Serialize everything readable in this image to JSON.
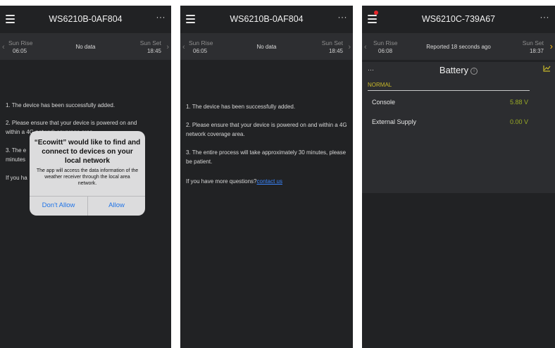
{
  "screen1": {
    "title": "WS6210B-0AF804",
    "more": "···",
    "sunrise_label": "Sun Rise",
    "sunrise_time": "06:05",
    "status": "No data",
    "sunset_label": "Sun Set",
    "sunset_time": "18:45",
    "msg1": "1. The device has been successfully added.",
    "msg2a": "2. Please ensure that your device is powered on and",
    "msg2b": "within a 4G network coverage area.",
    "msg3a": "3. The e",
    "msg3b": "minutes",
    "msg4": "If you ha",
    "alert": {
      "title": "“Ecowitt” would like to find and connect to devices on your local network",
      "body": "The app will access the data information of the weather receiver through the local area network.",
      "deny": "Don't Allow",
      "allow": "Allow"
    }
  },
  "screen2": {
    "title": "WS6210B-0AF804",
    "more": "···",
    "sunrise_label": "Sun Rise",
    "sunrise_time": "06:05",
    "status": "No data",
    "sunset_label": "Sun Set",
    "sunset_time": "18:45",
    "msg1": "1. The device has been successfully added.",
    "msg2": "2. Please ensure that your device is powered on and within a 4G network coverage area.",
    "msg3": "3. The entire process will take approximately 30 minutes, please be patient.",
    "msg4_prefix": "If you have more questions?",
    "msg4_link": "contact us"
  },
  "screen3": {
    "title": "WS6210C-739A67",
    "more": "···",
    "sunrise_label": "Sun Rise",
    "sunrise_time": "06:08",
    "status": "Reported 18 seconds ago",
    "sunset_label": "Sun Set",
    "sunset_time": "18:37",
    "battery": {
      "dots": "···",
      "title": "Battery",
      "status": "NORMAL",
      "rows": [
        {
          "label": "Console",
          "value": "5.88 V"
        },
        {
          "label": "External Supply",
          "value": "0.00 V"
        }
      ]
    }
  },
  "colors": {
    "background": "#212224",
    "bar": "#2d2e31",
    "accent_yellow": "#c9b92a",
    "value_green": "#9aab25",
    "link_blue": "#3a86ff",
    "alert_blue": "#1f74e8",
    "badge_red": "#e8262b"
  },
  "icons": [
    "hamburger-menu-icon",
    "more-icon",
    "chevron-left-icon",
    "chevron-right-icon",
    "info-icon",
    "chart-icon",
    "notification-dot-icon"
  ]
}
